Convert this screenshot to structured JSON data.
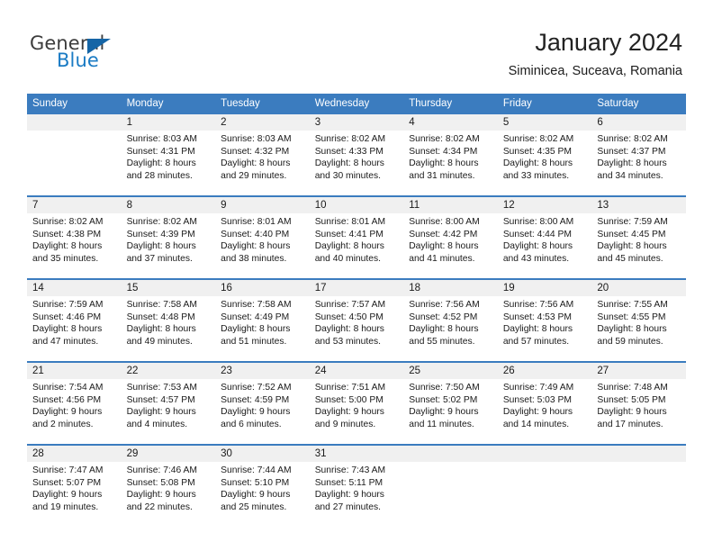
{
  "brand": {
    "word_one": "General",
    "word_two": "Blue",
    "triangle_icon": "triangle-icon"
  },
  "header": {
    "title": "January 2024",
    "subtitle": "Siminicea, Suceava, Romania"
  },
  "colors": {
    "header_blue": "#3b7cbf",
    "daynum_band": "#f0f0f0",
    "brand_blue": "#1a7bc4",
    "text": "#1a1a1a"
  },
  "weekday_headers": [
    "Sunday",
    "Monday",
    "Tuesday",
    "Wednesday",
    "Thursday",
    "Friday",
    "Saturday"
  ],
  "weeks": [
    [
      {
        "day": "",
        "lines": []
      },
      {
        "day": "1",
        "lines": [
          "Sunrise: 8:03 AM",
          "Sunset: 4:31 PM",
          "Daylight: 8 hours",
          "and 28 minutes."
        ]
      },
      {
        "day": "2",
        "lines": [
          "Sunrise: 8:03 AM",
          "Sunset: 4:32 PM",
          "Daylight: 8 hours",
          "and 29 minutes."
        ]
      },
      {
        "day": "3",
        "lines": [
          "Sunrise: 8:02 AM",
          "Sunset: 4:33 PM",
          "Daylight: 8 hours",
          "and 30 minutes."
        ]
      },
      {
        "day": "4",
        "lines": [
          "Sunrise: 8:02 AM",
          "Sunset: 4:34 PM",
          "Daylight: 8 hours",
          "and 31 minutes."
        ]
      },
      {
        "day": "5",
        "lines": [
          "Sunrise: 8:02 AM",
          "Sunset: 4:35 PM",
          "Daylight: 8 hours",
          "and 33 minutes."
        ]
      },
      {
        "day": "6",
        "lines": [
          "Sunrise: 8:02 AM",
          "Sunset: 4:37 PM",
          "Daylight: 8 hours",
          "and 34 minutes."
        ]
      }
    ],
    [
      {
        "day": "7",
        "lines": [
          "Sunrise: 8:02 AM",
          "Sunset: 4:38 PM",
          "Daylight: 8 hours",
          "and 35 minutes."
        ]
      },
      {
        "day": "8",
        "lines": [
          "Sunrise: 8:02 AM",
          "Sunset: 4:39 PM",
          "Daylight: 8 hours",
          "and 37 minutes."
        ]
      },
      {
        "day": "9",
        "lines": [
          "Sunrise: 8:01 AM",
          "Sunset: 4:40 PM",
          "Daylight: 8 hours",
          "and 38 minutes."
        ]
      },
      {
        "day": "10",
        "lines": [
          "Sunrise: 8:01 AM",
          "Sunset: 4:41 PM",
          "Daylight: 8 hours",
          "and 40 minutes."
        ]
      },
      {
        "day": "11",
        "lines": [
          "Sunrise: 8:00 AM",
          "Sunset: 4:42 PM",
          "Daylight: 8 hours",
          "and 41 minutes."
        ]
      },
      {
        "day": "12",
        "lines": [
          "Sunrise: 8:00 AM",
          "Sunset: 4:44 PM",
          "Daylight: 8 hours",
          "and 43 minutes."
        ]
      },
      {
        "day": "13",
        "lines": [
          "Sunrise: 7:59 AM",
          "Sunset: 4:45 PM",
          "Daylight: 8 hours",
          "and 45 minutes."
        ]
      }
    ],
    [
      {
        "day": "14",
        "lines": [
          "Sunrise: 7:59 AM",
          "Sunset: 4:46 PM",
          "Daylight: 8 hours",
          "and 47 minutes."
        ]
      },
      {
        "day": "15",
        "lines": [
          "Sunrise: 7:58 AM",
          "Sunset: 4:48 PM",
          "Daylight: 8 hours",
          "and 49 minutes."
        ]
      },
      {
        "day": "16",
        "lines": [
          "Sunrise: 7:58 AM",
          "Sunset: 4:49 PM",
          "Daylight: 8 hours",
          "and 51 minutes."
        ]
      },
      {
        "day": "17",
        "lines": [
          "Sunrise: 7:57 AM",
          "Sunset: 4:50 PM",
          "Daylight: 8 hours",
          "and 53 minutes."
        ]
      },
      {
        "day": "18",
        "lines": [
          "Sunrise: 7:56 AM",
          "Sunset: 4:52 PM",
          "Daylight: 8 hours",
          "and 55 minutes."
        ]
      },
      {
        "day": "19",
        "lines": [
          "Sunrise: 7:56 AM",
          "Sunset: 4:53 PM",
          "Daylight: 8 hours",
          "and 57 minutes."
        ]
      },
      {
        "day": "20",
        "lines": [
          "Sunrise: 7:55 AM",
          "Sunset: 4:55 PM",
          "Daylight: 8 hours",
          "and 59 minutes."
        ]
      }
    ],
    [
      {
        "day": "21",
        "lines": [
          "Sunrise: 7:54 AM",
          "Sunset: 4:56 PM",
          "Daylight: 9 hours",
          "and 2 minutes."
        ]
      },
      {
        "day": "22",
        "lines": [
          "Sunrise: 7:53 AM",
          "Sunset: 4:57 PM",
          "Daylight: 9 hours",
          "and 4 minutes."
        ]
      },
      {
        "day": "23",
        "lines": [
          "Sunrise: 7:52 AM",
          "Sunset: 4:59 PM",
          "Daylight: 9 hours",
          "and 6 minutes."
        ]
      },
      {
        "day": "24",
        "lines": [
          "Sunrise: 7:51 AM",
          "Sunset: 5:00 PM",
          "Daylight: 9 hours",
          "and 9 minutes."
        ]
      },
      {
        "day": "25",
        "lines": [
          "Sunrise: 7:50 AM",
          "Sunset: 5:02 PM",
          "Daylight: 9 hours",
          "and 11 minutes."
        ]
      },
      {
        "day": "26",
        "lines": [
          "Sunrise: 7:49 AM",
          "Sunset: 5:03 PM",
          "Daylight: 9 hours",
          "and 14 minutes."
        ]
      },
      {
        "day": "27",
        "lines": [
          "Sunrise: 7:48 AM",
          "Sunset: 5:05 PM",
          "Daylight: 9 hours",
          "and 17 minutes."
        ]
      }
    ],
    [
      {
        "day": "28",
        "lines": [
          "Sunrise: 7:47 AM",
          "Sunset: 5:07 PM",
          "Daylight: 9 hours",
          "and 19 minutes."
        ]
      },
      {
        "day": "29",
        "lines": [
          "Sunrise: 7:46 AM",
          "Sunset: 5:08 PM",
          "Daylight: 9 hours",
          "and 22 minutes."
        ]
      },
      {
        "day": "30",
        "lines": [
          "Sunrise: 7:44 AM",
          "Sunset: 5:10 PM",
          "Daylight: 9 hours",
          "and 25 minutes."
        ]
      },
      {
        "day": "31",
        "lines": [
          "Sunrise: 7:43 AM",
          "Sunset: 5:11 PM",
          "Daylight: 9 hours",
          "and 27 minutes."
        ]
      },
      {
        "day": "",
        "lines": []
      },
      {
        "day": "",
        "lines": []
      },
      {
        "day": "",
        "lines": []
      }
    ]
  ]
}
